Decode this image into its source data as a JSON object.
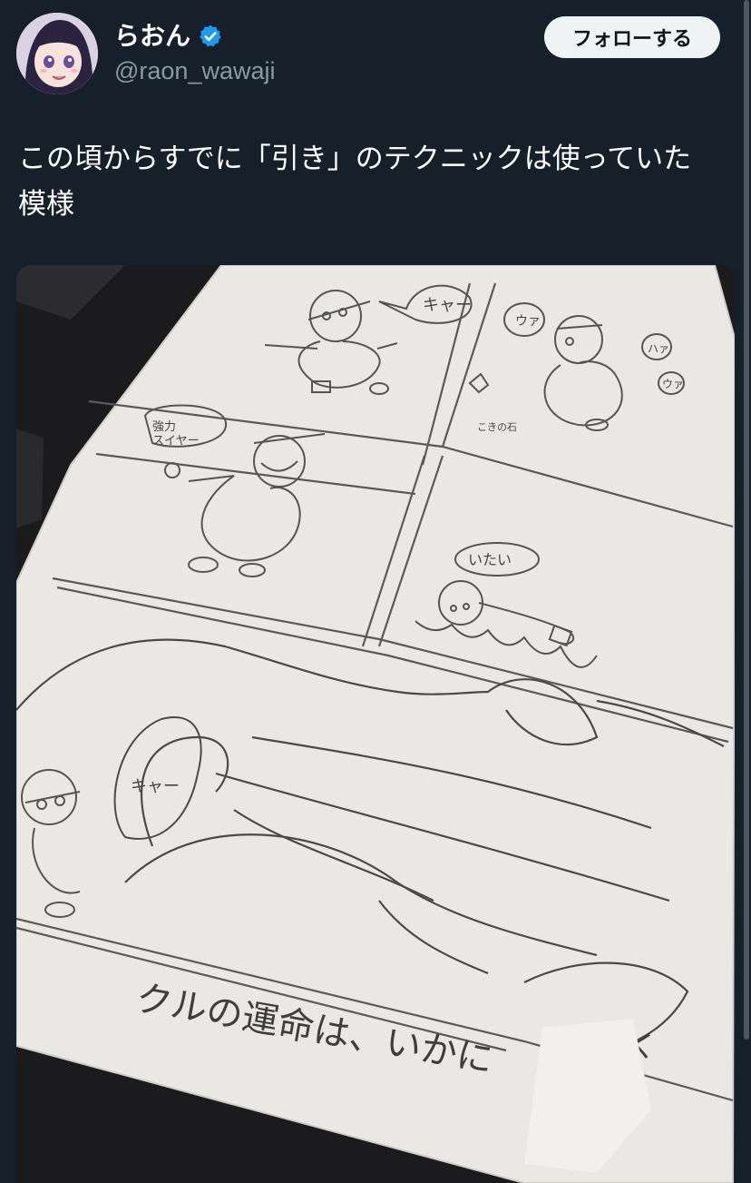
{
  "tweet": {
    "author": {
      "display_name": "らおん",
      "handle": "@raon_wawaji",
      "verified": true,
      "verified_icon": "verified-badge-icon"
    },
    "follow_label": "フォローする",
    "text": "この頃からすでに「引き」のテクニックは使っていた\n模様",
    "media": {
      "description_icon": "photo",
      "drawing_texts": {
        "bubble_1": "キャー",
        "bubble_2": "ウァ",
        "bubble_3": "ハァ",
        "bubble_4": "ウァ",
        "stone_label": "こきの石",
        "bubble_5": "強力\nスイヤー",
        "bubble_6": "いたい",
        "bubble_7": "キャー",
        "caption": "クルの運命は、いかに",
        "continued": "つづく"
      }
    }
  },
  "colors": {
    "background": "#15202b",
    "secondary_text": "#8b98a5",
    "verified_blue": "#1d9bf0",
    "follow_bg": "#eff3f4"
  }
}
